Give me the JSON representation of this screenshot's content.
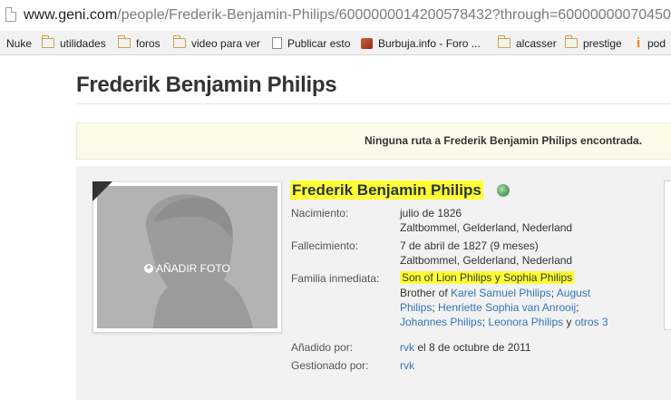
{
  "browser": {
    "url_host": "www.geni.com",
    "url_rest": "/people/Frederik-Benjamin-Philips/6000000014200578432?through=60000000070450"
  },
  "bookmarks": [
    {
      "label": "Nuke",
      "icon": "none"
    },
    {
      "label": "utilidades",
      "icon": "folder-icon"
    },
    {
      "label": "foros",
      "icon": "folder-icon"
    },
    {
      "label": "video para ver",
      "icon": "folder-icon"
    },
    {
      "label": "Publicar esto",
      "icon": "doc-icon"
    },
    {
      "label": "Burbuja.info - Foro ...",
      "icon": "burbuja-icon"
    },
    {
      "label": "alcasser",
      "icon": "folder-icon"
    },
    {
      "label": "prestige",
      "icon": "folder-icon"
    },
    {
      "label": "pod",
      "icon": "i-icon"
    }
  ],
  "page": {
    "title": "Frederik Benjamin Philips",
    "notice": "Ninguna ruta a Frederik Benjamin Philips encontrada."
  },
  "profile": {
    "name": "Frederik Benjamin Philips",
    "add_photo": "AÑADIR FOTO",
    "birth": {
      "label": "Nacimiento:",
      "date": "julio de 1826",
      "place": "Zaltbommel, Gelderland, Nederland"
    },
    "death": {
      "label": "Fallecimiento:",
      "date": "7 de abril de 1827 (9 meses)",
      "place": "Zaltbommel, Gelderland, Nederland"
    },
    "family": {
      "label": "Familia inmediata:",
      "parents": "Son of Lion Philips y Sophia Philips",
      "brother_prefix": "Brother of",
      "sibling_1": "Karel Samuel Philips",
      "sep_1": ";",
      "sibling_2a": "August",
      "sibling_2b": "Philips",
      "sep_2": ";",
      "sibling_3": "Henriette Sophia van Anrooij",
      "sep_3": ";",
      "sibling_4": "Johannes Philips",
      "sep_4": ";",
      "sibling_5": "Leonora Philips",
      "and_word": "y",
      "others": "otros 3"
    },
    "added": {
      "label": "Añadido por:",
      "user": "rvk",
      "text": "el 8 de octubre de 2011"
    },
    "managed": {
      "label": "Gestionado por:",
      "user": "rvk"
    }
  },
  "colors": {
    "highlight": "#ffff33",
    "link": "#3574b9",
    "notice_bg": "#fcfbea",
    "card_bg": "#f2f2f2"
  }
}
